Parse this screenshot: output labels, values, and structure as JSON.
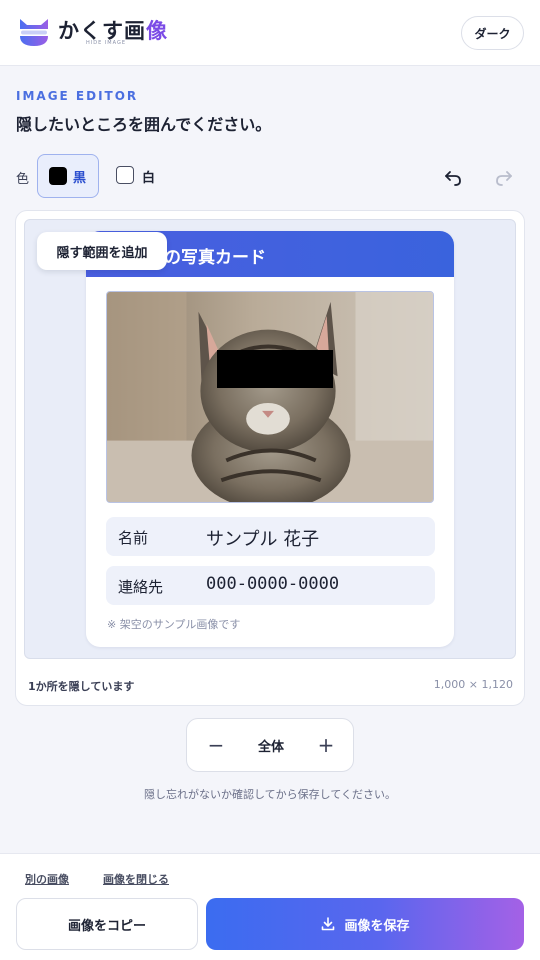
{
  "app": {
    "brand_main": "かくす画",
    "brand_accent": "像",
    "brand_sub": "HIDE IMAGE",
    "theme_button": "ダーク"
  },
  "intro": {
    "eyebrow": "IMAGE EDITOR",
    "heading": "隠したいところを囲んでください。"
  },
  "toolbar": {
    "color_label": "色",
    "black_label": "黒",
    "white_label": "白",
    "selected_color": "black",
    "undo_icon": "undo-icon",
    "redo_icon": "redo-icon"
  },
  "editor": {
    "add_area_button": "隠す範囲を追加",
    "card_title": "の写真カード",
    "fields": [
      {
        "key": "名前",
        "value": "サンプル 花子"
      },
      {
        "key": "連絡先",
        "value": "000-0000-0000"
      }
    ],
    "disclaimer": "※ 架空のサンプル画像です",
    "status_hidden_count": "1か所を隠しています",
    "image_size": "1,000 × 1,120"
  },
  "zoom": {
    "minus": "−",
    "label": "全体",
    "plus": "+"
  },
  "hint": "隠し忘れがないか確認してから保存してください。",
  "footer": {
    "link_other": "別の画像",
    "link_close": "画像を閉じる",
    "copy_button": "画像をコピー",
    "save_button": "画像を保存"
  },
  "colors": {
    "accent_blue": "#4b6fe0",
    "save_gradient_start": "#3b6cf0",
    "save_gradient_end": "#a461e6",
    "mask": "#000000"
  }
}
